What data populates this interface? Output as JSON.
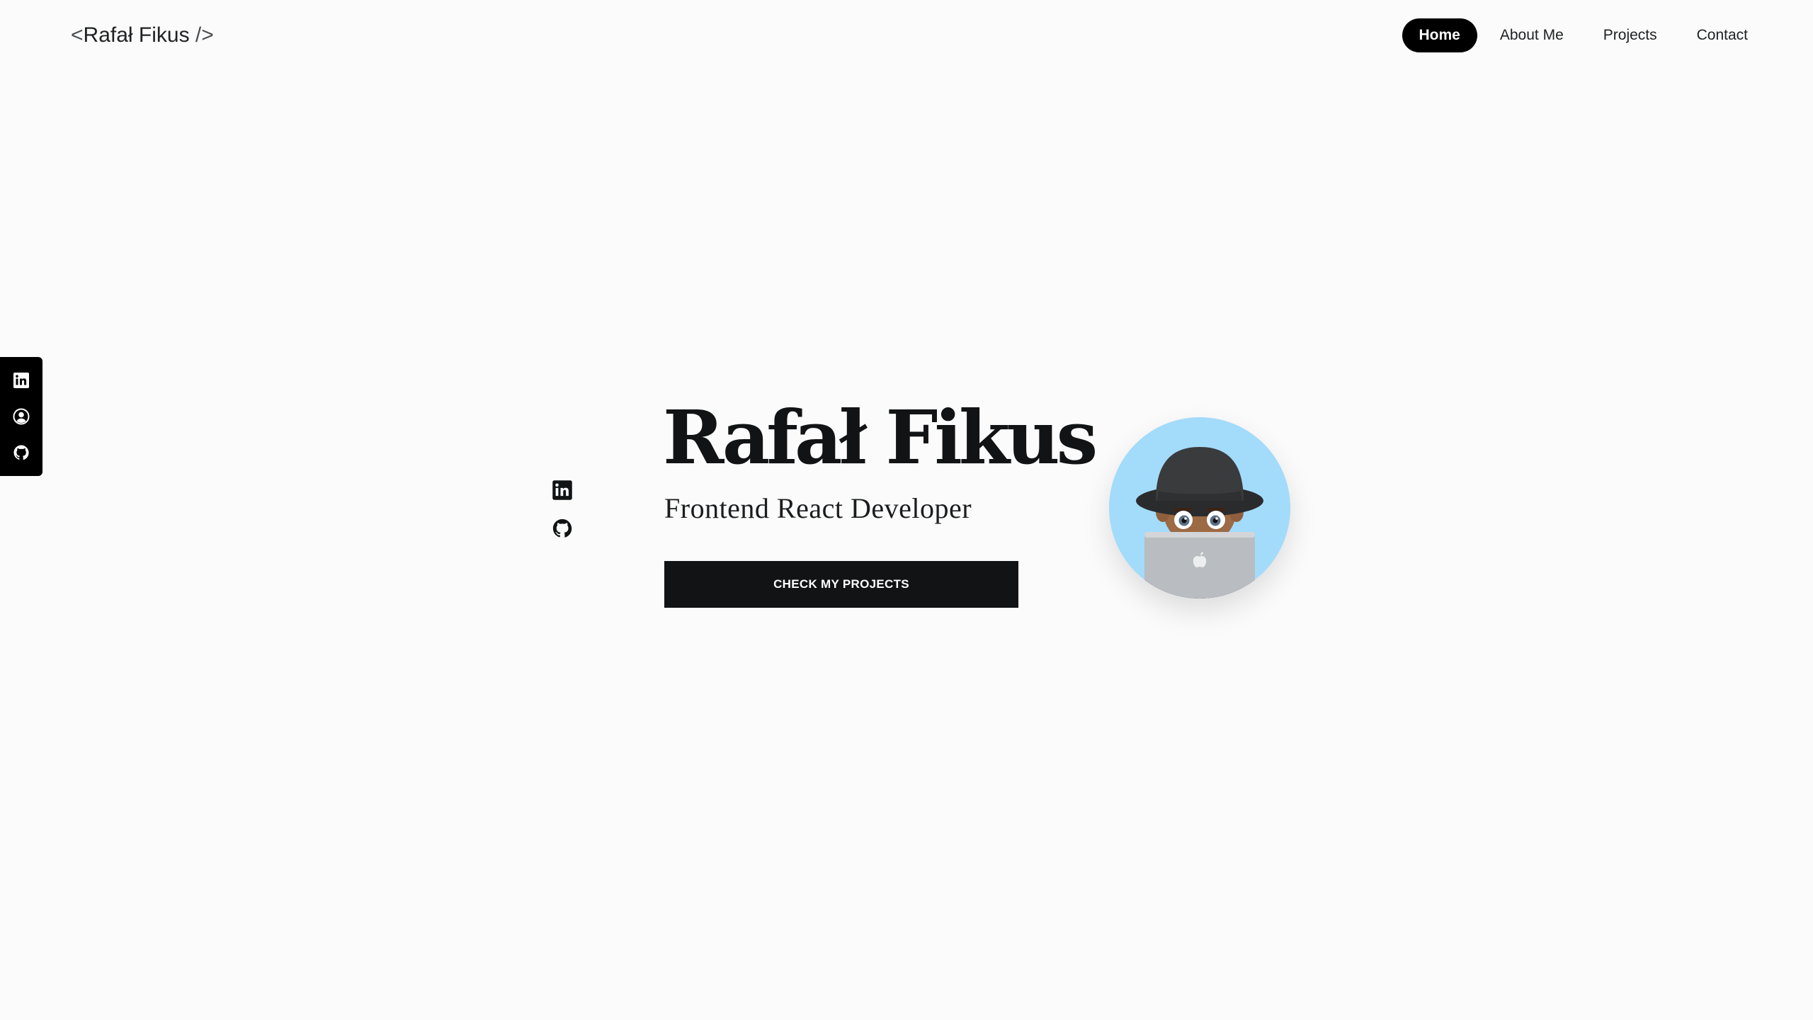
{
  "header": {
    "logo_open": "<",
    "logo_name": "Rafał Fikus",
    "logo_close": " />"
  },
  "nav": {
    "items": [
      {
        "label": "Home",
        "active": true
      },
      {
        "label": "About Me",
        "active": false
      },
      {
        "label": "Projects",
        "active": false
      },
      {
        "label": "Contact",
        "active": false
      }
    ]
  },
  "side_bar": {
    "icons": [
      "linkedin-icon",
      "user-circle-icon",
      "github-icon"
    ]
  },
  "hero": {
    "name": "Rafał Fikus",
    "subtitle": "Frontend React Developer",
    "cta_label": "CHECK MY PROJECTS",
    "socials": [
      "linkedin-icon",
      "github-icon"
    ]
  },
  "colors": {
    "background": "#fbfbfb",
    "text": "#141617",
    "accent_dark": "#111314",
    "avatar_bg": "#a3dbfb"
  }
}
